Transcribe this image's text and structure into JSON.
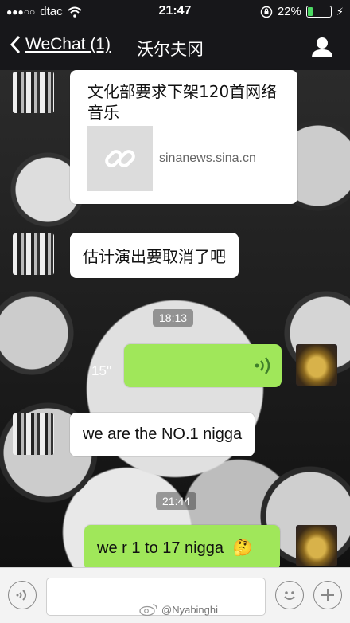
{
  "status_bar": {
    "signal_dots": "●●●○○",
    "carrier": "dtac",
    "time": "21:47",
    "battery_percent": "22%",
    "battery_level": 0.22
  },
  "nav": {
    "back_label": "WeChat (1)",
    "title": "沃尔夫冈"
  },
  "messages": {
    "link_card": {
      "title": "文化部要求下架120首网络音乐",
      "domain": "sinanews.sina.cn"
    },
    "msg1": "估计演出要取消了吧",
    "time1": "18:13",
    "voice_duration": "15''",
    "msg2": "we are the NO.1 nigga",
    "time2": "21:44",
    "msg3": "we r 1 to 17 nigga",
    "msg3_emoji": "🤔"
  },
  "watermark": "@Nyabinghi",
  "colors": {
    "accent_green": "#a0e75a",
    "bar_dark": "#17171a",
    "battery_green": "#4cd964"
  }
}
